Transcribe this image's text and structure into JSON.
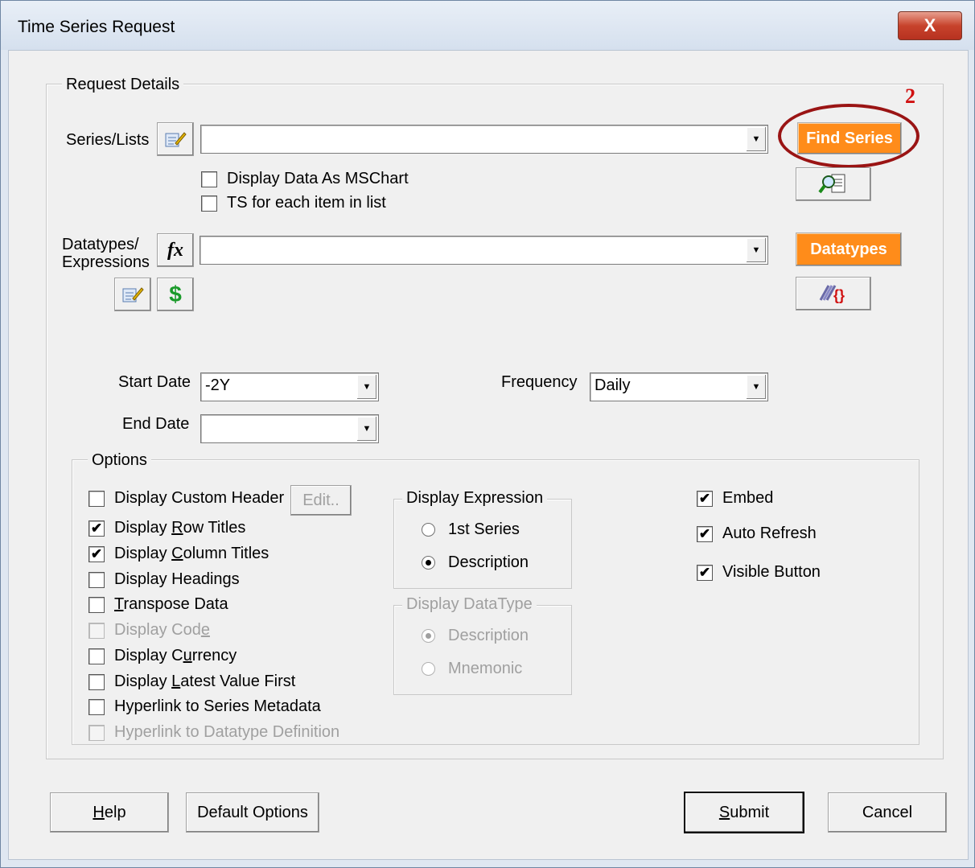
{
  "window": {
    "title": "Time Series Request",
    "close_label": "X"
  },
  "request_details": {
    "legend": "Request Details",
    "series_lists_label": "Series/Lists",
    "series_value": "",
    "find_series_label": "Find Series",
    "display_mschart_label": "Display Data As MSChart",
    "display_mschart_checked": false,
    "ts_each_item_label": "TS for each item in list",
    "ts_each_item_checked": false,
    "datatypes_label_1": "Datatypes/",
    "datatypes_label_2": "Expressions",
    "datatypes_value": "",
    "datatypes_button_label": "Datatypes",
    "fx_label": "fx",
    "currency_symbol": "$",
    "start_date_label": "Start Date",
    "start_date_value": "-2Y",
    "end_date_label": "End Date",
    "end_date_value": "",
    "frequency_label": "Frequency",
    "frequency_value": "Daily"
  },
  "options": {
    "legend": "Options",
    "edit_label": "Edit..",
    "checkboxes": [
      {
        "pre": "Display Custom Header",
        "u": "",
        "post": "",
        "checked": false,
        "enabled": true
      },
      {
        "pre": "Display ",
        "u": "R",
        "post": "ow Titles",
        "checked": true,
        "enabled": true
      },
      {
        "pre": "Display ",
        "u": "C",
        "post": "olumn Titles",
        "checked": true,
        "enabled": true
      },
      {
        "pre": "Display Headings",
        "u": "",
        "post": "",
        "checked": false,
        "enabled": true
      },
      {
        "pre": "",
        "u": "T",
        "post": "ranspose Data",
        "checked": false,
        "enabled": true
      },
      {
        "pre": "Display Cod",
        "u": "e",
        "post": "",
        "checked": false,
        "enabled": false
      },
      {
        "pre": "Display C",
        "u": "u",
        "post": "rrency",
        "checked": false,
        "enabled": true
      },
      {
        "pre": "Display ",
        "u": "L",
        "post": "atest Value First",
        "checked": false,
        "enabled": true
      },
      {
        "pre": "Hyperlink to Series Metadata",
        "u": "",
        "post": "",
        "checked": false,
        "enabled": true
      },
      {
        "pre": "Hyperlink to Datatype Definition",
        "u": "",
        "post": "",
        "checked": false,
        "enabled": false
      }
    ],
    "display_expression": {
      "legend": "Display Expression",
      "opt1": "1st Series",
      "opt2": "Description",
      "selected": "Description"
    },
    "display_datatype": {
      "legend": "Display DataType",
      "opt1": "Description",
      "opt2": "Mnemonic",
      "selected": "Description",
      "enabled": false
    },
    "right_checks": [
      {
        "label": "Embed",
        "checked": true
      },
      {
        "label": "Auto Refresh",
        "checked": true
      },
      {
        "label": "Visible Button",
        "checked": true
      }
    ]
  },
  "footer": {
    "help_u": "H",
    "help_rest": "elp",
    "default_options": "Default Options",
    "submit_u": "S",
    "submit_rest": "ubmit",
    "cancel": "Cancel"
  },
  "annotation": {
    "number": "2",
    "color": "#9a1414"
  },
  "colors": {
    "accent_orange": "#ff8c1a",
    "currency_green": "#1a9a2a"
  },
  "check_mark": "✔"
}
